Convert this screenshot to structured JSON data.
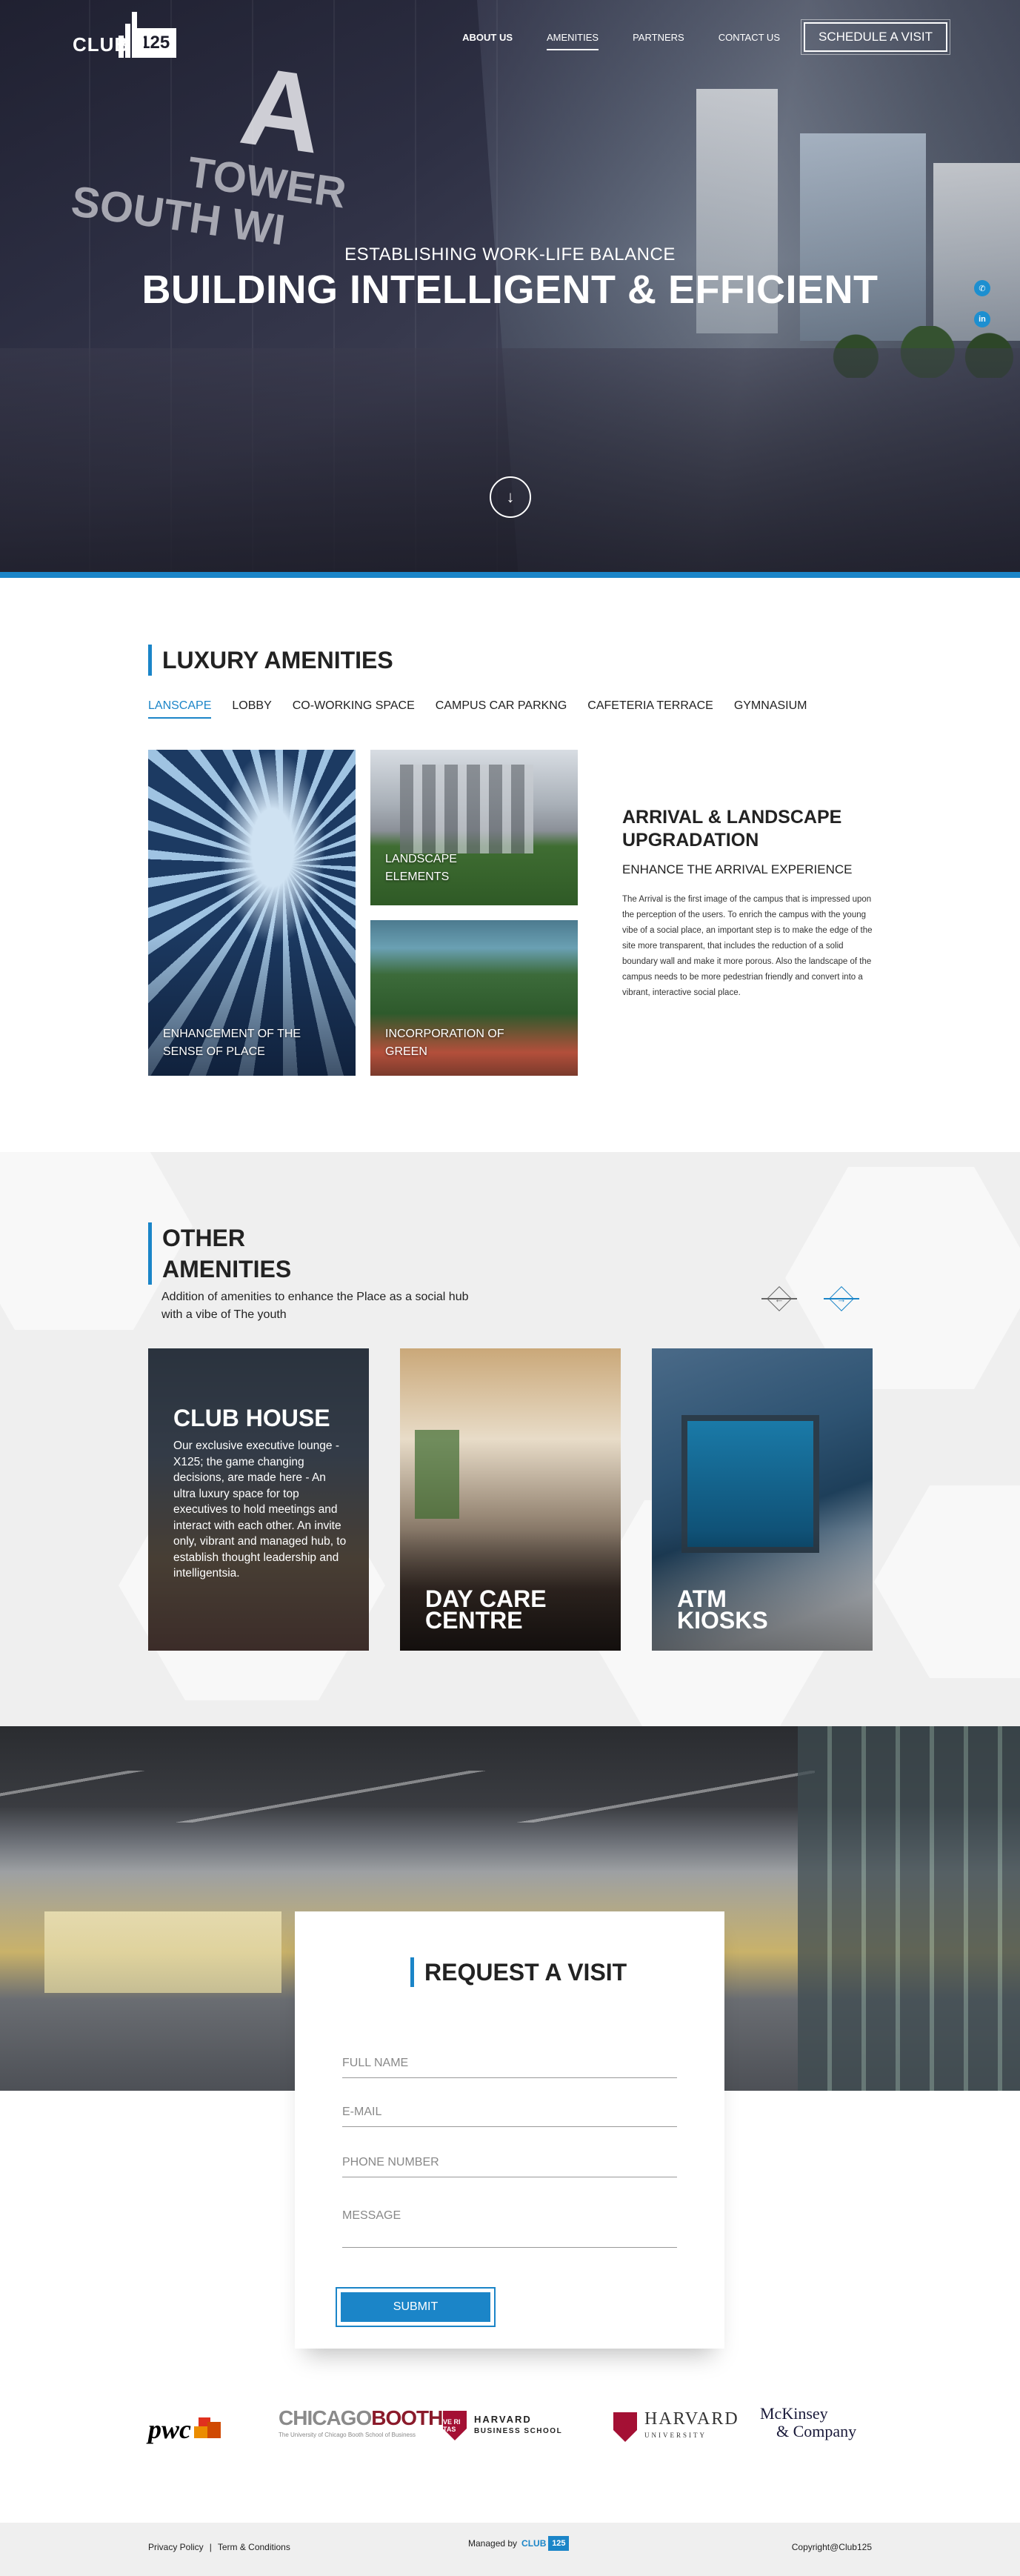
{
  "nav": {
    "logo_text": "CLUB",
    "logo_number": "125",
    "links": [
      {
        "label": "ABOUT US"
      },
      {
        "label": "AMENITIES"
      },
      {
        "label": "PARTNERS"
      },
      {
        "label": "CONTACT US"
      }
    ],
    "cta": "SCHEDULE A VISIT"
  },
  "hero": {
    "subtitle": "ESTABLISHING WORK-LIFE BALANCE",
    "title": "BUILDING INTELLIGENT & EFFICIENT",
    "sign_letter": "A",
    "sign_line1": "TOWER",
    "sign_line2": "SOUTH WI",
    "social": [
      {
        "icon": "whatsapp-icon",
        "glyph": "✆"
      },
      {
        "icon": "linkedin-icon",
        "glyph": "in"
      }
    ],
    "scroll_glyph": "↓",
    "accent_color": "#1b85c8"
  },
  "luxury": {
    "title_light": "LUXURY ",
    "title_bold": "AMENITIES",
    "tabs": [
      {
        "label": "LANSCAPE"
      },
      {
        "label": "LOBBY"
      },
      {
        "label": "CO-WORKING SPACE"
      },
      {
        "label": "CAMPUS CAR PARKNG"
      },
      {
        "label": "CAFETERIA TERRACE"
      },
      {
        "label": "GYMNASIUM"
      }
    ],
    "cards": [
      {
        "caption": "ENHANCEMENT OF THE SENSE OF PLACE"
      },
      {
        "caption": "LANDSCAPE ELEMENTS"
      },
      {
        "caption": "INCORPORATION OF GREEN"
      }
    ],
    "heading": "ARRIVAL & LANDSCAPE UPGRADATION",
    "subheading": "ENHANCE THE ARRIVAL EXPERIENCE",
    "body": "The Arrival is the first image of the campus that is impressed upon the perception of the users. To enrich the campus with the young vibe of a social place, an important step is to make the edge of the site more transparent, that includes the reduction of a solid boundary wall and make it more porous. Also the landscape of the campus needs to be more pedestrian friendly and convert into a vibrant, interactive social place."
  },
  "other": {
    "title_light": "OTHER",
    "title_bold": "AMENITIES",
    "description": "Addition of amenities to enhance the Place as a social hub with a vibe of The youth",
    "prev_glyph": "←",
    "next_glyph": "→",
    "cards": [
      {
        "title": "CLUB HOUSE",
        "description": "Our exclusive executive lounge - X125; the game changing decisions, are made here - An ultra luxury space for top executives to hold meetings and interact with each other. An invite only, vibrant and managed hub, to establish thought leadership and intelligentsia."
      },
      {
        "title": "DAY CARE CENTRE"
      },
      {
        "title": "ATM KIOSKS"
      }
    ]
  },
  "visit": {
    "title_light": "REQUEST A ",
    "title_bold": "VISIT",
    "fields": {
      "name_placeholder": "FULL NAME",
      "email_placeholder": "E-MAIL",
      "phone_placeholder": "PHONE NUMBER",
      "message_placeholder": "MESSAGE"
    },
    "submit": "SUBMIT"
  },
  "partners": {
    "pwc": "pwc",
    "chicago_booth_1": "CHICAGO",
    "chicago_booth_2": "BOOTH",
    "chicago_booth_sub": "The University of Chicago Booth School of Business",
    "hbs_line1": "HARVARD",
    "hbs_line2": "BUSINESS SCHOOL",
    "hbs_shield": "VE RI TAS",
    "hu_line1": "HARVARD",
    "hu_line2": "UNIVERSITY",
    "mckinsey_line1": "McKinsey",
    "mckinsey_line2": "& Company"
  },
  "footer": {
    "privacy": "Privacy Policy",
    "separator": "|",
    "terms": "Term & Conditions",
    "managed_by": "Managed by",
    "managed_logo_text": "CLUB",
    "managed_logo_number": "125",
    "copyright": "Copyright@Club125"
  }
}
